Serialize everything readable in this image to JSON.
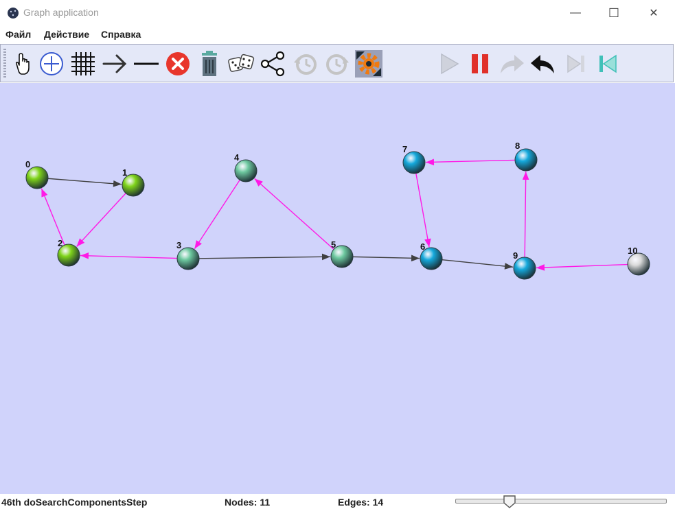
{
  "window": {
    "title": "Graph application",
    "minimize_glyph": "—",
    "maximize_glyph": "☐",
    "close_glyph": "✕"
  },
  "menu": [
    {
      "label": "Файл"
    },
    {
      "label": "Действие"
    },
    {
      "label": "Справка"
    }
  ],
  "toolbar": [
    {
      "name": "hand-icon",
      "enabled": true
    },
    {
      "name": "add-node-icon",
      "enabled": true
    },
    {
      "name": "grid-icon",
      "enabled": true
    },
    {
      "name": "directed-edge-icon",
      "enabled": true
    },
    {
      "name": "undirected-edge-icon",
      "enabled": true
    },
    {
      "name": "delete-icon",
      "enabled": true
    },
    {
      "name": "trash-icon",
      "enabled": true
    },
    {
      "name": "dice-icon",
      "enabled": true
    },
    {
      "name": "share-graph-icon",
      "enabled": true
    },
    {
      "name": "clock-back-icon",
      "enabled": false
    },
    {
      "name": "clock-forward-icon",
      "enabled": false
    },
    {
      "name": "settings-gear-icon",
      "enabled": true
    },
    {
      "name": "play-icon",
      "enabled": false
    },
    {
      "name": "pause-icon",
      "enabled": true
    },
    {
      "name": "redo-arrow-icon",
      "enabled": false
    },
    {
      "name": "undo-arrow-icon",
      "enabled": true
    },
    {
      "name": "step-end-icon",
      "enabled": false
    },
    {
      "name": "step-start-icon",
      "enabled": true
    }
  ],
  "graph": {
    "nodes": [
      {
        "id": "0",
        "label": "0",
        "color": "#7fd41a"
      },
      {
        "id": "1",
        "label": "1",
        "color": "#7fd41a"
      },
      {
        "id": "2",
        "label": "2",
        "color": "#7fd41a"
      },
      {
        "id": "3",
        "label": "3",
        "color": "#6ec9a0"
      },
      {
        "id": "4",
        "label": "4",
        "color": "#6ec9a0"
      },
      {
        "id": "5",
        "label": "5",
        "color": "#6ec9a0"
      },
      {
        "id": "6",
        "label": "6",
        "color": "#15a9dc"
      },
      {
        "id": "7",
        "label": "7",
        "color": "#15a9dc"
      },
      {
        "id": "8",
        "label": "8",
        "color": "#15a9dc"
      },
      {
        "id": "9",
        "label": "9",
        "color": "#15a9dc"
      },
      {
        "id": "10",
        "label": "10",
        "color": "#d9d9d9"
      }
    ],
    "edges": [
      {
        "from": "0",
        "to": "1",
        "color": "#404040"
      },
      {
        "from": "1",
        "to": "2",
        "color": "#ff19e6"
      },
      {
        "from": "2",
        "to": "0",
        "color": "#ff19e6"
      },
      {
        "from": "3",
        "to": "2",
        "color": "#ff19e6"
      },
      {
        "from": "4",
        "to": "3",
        "color": "#ff19e6"
      },
      {
        "from": "5",
        "to": "4",
        "color": "#ff19e6"
      },
      {
        "from": "3",
        "to": "5",
        "color": "#404040"
      },
      {
        "from": "5",
        "to": "6",
        "color": "#404040"
      },
      {
        "from": "7",
        "to": "6",
        "color": "#ff19e6"
      },
      {
        "from": "8",
        "to": "7",
        "color": "#ff19e6"
      },
      {
        "from": "9",
        "to": "8",
        "color": "#ff19e6"
      },
      {
        "from": "6",
        "to": "9",
        "color": "#404040"
      },
      {
        "from": "10",
        "to": "9",
        "color": "#ff19e6"
      }
    ]
  },
  "status": {
    "step": "46th doSearchComponentsStep",
    "nodes": "Nodes: 11",
    "edges": "Edges: 14",
    "slider_fraction": 0.255
  },
  "colors": {
    "canvas": "#d0d3fb",
    "toolbar": "#e4e8f8",
    "edge_tree": "#ff19e6",
    "edge_normal": "#404040"
  }
}
